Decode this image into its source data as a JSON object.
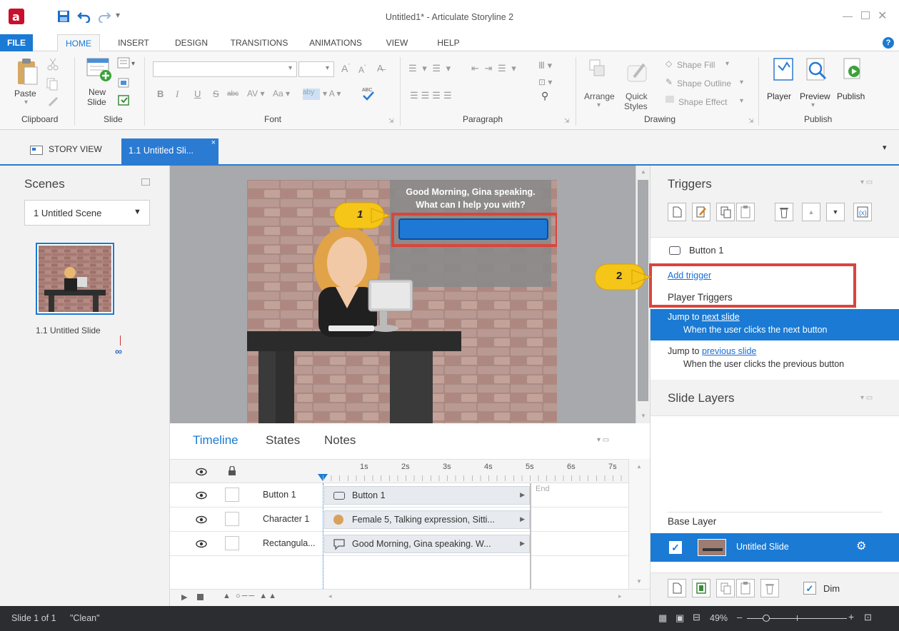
{
  "window": {
    "title": "Untitled1* - Articulate Storyline 2"
  },
  "menu": [
    "FILE",
    "HOME",
    "INSERT",
    "DESIGN",
    "TRANSITIONS",
    "ANIMATIONS",
    "VIEW",
    "HELP"
  ],
  "ribbon": {
    "clipboard": {
      "paste": "Paste",
      "group": "Clipboard"
    },
    "slide": {
      "new_slide_1": "New",
      "new_slide_2": "Slide",
      "group": "Slide"
    },
    "font": {
      "group": "Font"
    },
    "paragraph": {
      "group": "Paragraph"
    },
    "drawing": {
      "arrange": "Arrange",
      "quick_styles_1": "Quick",
      "quick_styles_2": "Styles",
      "shape_fill": "Shape Fill",
      "shape_outline": "Shape Outline",
      "shape_effect": "Shape Effect",
      "group": "Drawing"
    },
    "publish": {
      "player": "Player",
      "preview": "Preview",
      "publish": "Publish",
      "group": "Publish"
    }
  },
  "doc_tabs": {
    "story_view": "STORY VIEW",
    "active": "1.1 Untitled Sli..."
  },
  "scenes": {
    "title": "Scenes",
    "dropdown": "1 Untitled Scene",
    "slide_label": "1.1 Untitled Slide"
  },
  "slide": {
    "bubble_line1": "Good Morning, Gina speaking.",
    "bubble_line2": "What can I help you with?"
  },
  "callouts": {
    "one": "1",
    "two": "2"
  },
  "timeline": {
    "tabs": [
      "Timeline",
      "States",
      "Notes"
    ],
    "ticks": [
      "1s",
      "2s",
      "3s",
      "4s",
      "5s",
      "6s",
      "7s"
    ],
    "end_label": "End",
    "rows": [
      {
        "name": "Button 1",
        "bar": "Button 1"
      },
      {
        "name": "Character 1",
        "bar": "Female 5, Talking expression, Sitti..."
      },
      {
        "name": "Rectangula...",
        "bar": "Good Morning, Gina speaking. W..."
      }
    ]
  },
  "triggers": {
    "title": "Triggers",
    "object": "Button 1",
    "add_trigger": "Add trigger",
    "player_triggers": "Player Triggers",
    "items": [
      {
        "prefix": "Jump to ",
        "link": "next slide",
        "condition": "When the user clicks the next button"
      },
      {
        "prefix": "Jump to ",
        "link": "previous slide",
        "condition": "When the user clicks the previous button"
      }
    ]
  },
  "layers": {
    "title": "Slide Layers",
    "base_layer": "Base Layer",
    "slide_name": "Untitled Slide",
    "dim": "Dim"
  },
  "status": {
    "slide_info": "Slide 1 of 1",
    "theme": "\"Clean\"",
    "zoom": "49%"
  },
  "colors": {
    "accent": "#1a7ad4",
    "callout_red": "#d9453d",
    "status_bar": "#2b2d30"
  }
}
